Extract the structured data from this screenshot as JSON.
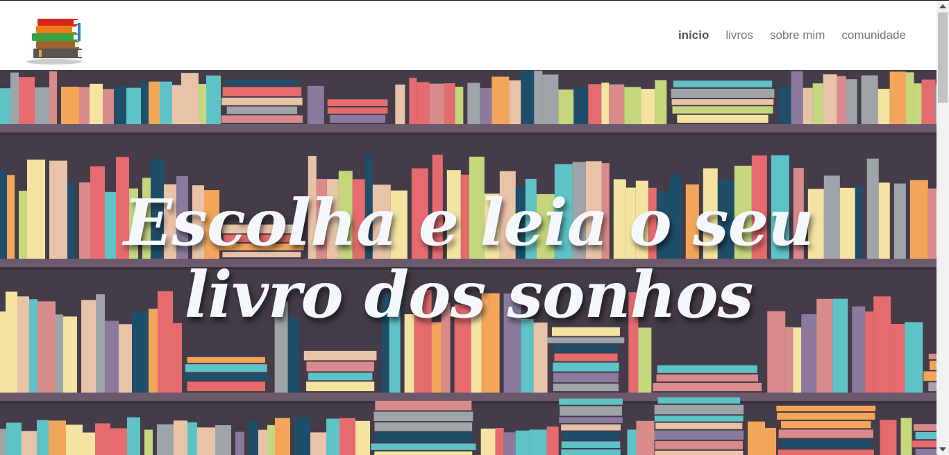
{
  "nav": {
    "items": [
      {
        "label": "início",
        "active": true
      },
      {
        "label": "livros",
        "active": false
      },
      {
        "label": "sobre mim",
        "active": false
      },
      {
        "label": "comunidade",
        "active": false
      }
    ]
  },
  "hero": {
    "title": "Escolha e leia o seu livro dos sonhos"
  },
  "colors": {
    "shelf_background": "#443c48",
    "shelf_board": "#6b5a6c",
    "book_palette": [
      "#e56b6f",
      "#f4e3a1",
      "#5ec3c7",
      "#c4d77c",
      "#f3a65a",
      "#9fa4a9",
      "#1f4e6b",
      "#e9c3a8",
      "#8b7a9e",
      "#d98b8b"
    ]
  },
  "icons": {
    "logo": "book-stack-icon"
  }
}
